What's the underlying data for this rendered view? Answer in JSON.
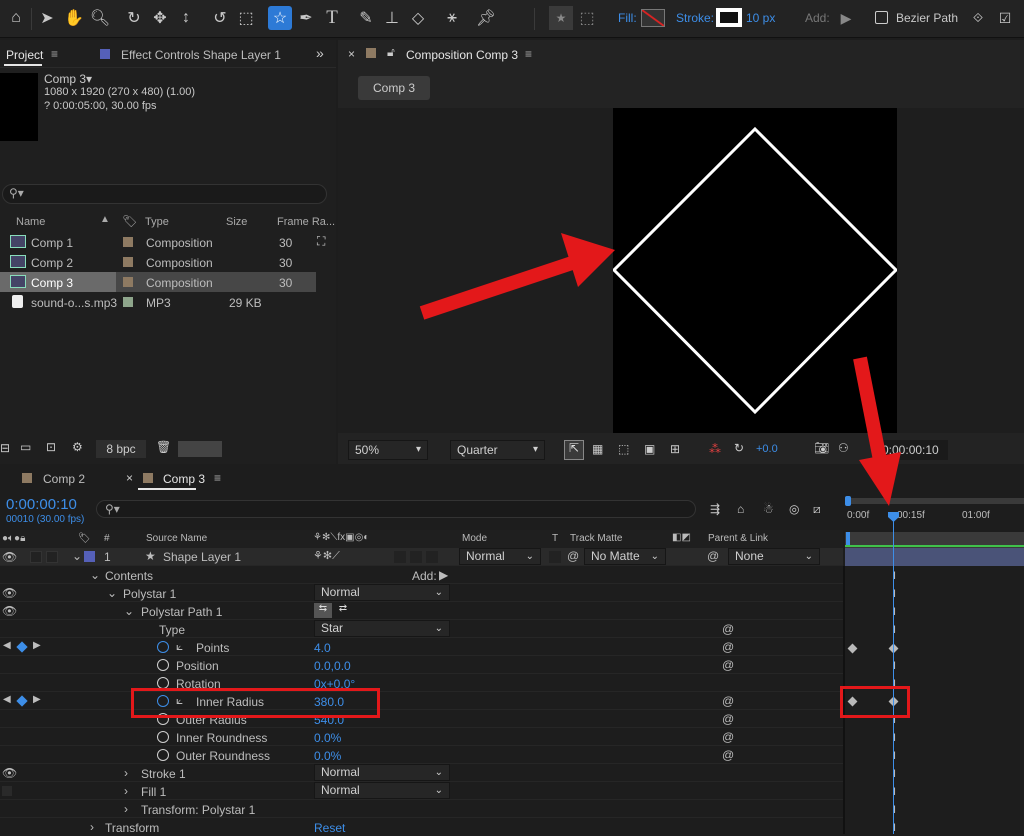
{
  "toolbar": {
    "fill_label": "Fill:",
    "stroke_label": "Stroke:",
    "stroke_width": "10 px",
    "add_label": "Add:",
    "bezier_label": "Bezier Path"
  },
  "project": {
    "tab_project": "Project",
    "tab_effect": "Effect Controls Shape Layer 1",
    "item_name": "Comp 3▾",
    "item_size": "1080 x 1920  (270 x 480) (1.00)",
    "item_duration": "? 0:00:05:00, 30.00 fps",
    "search_placeholder": "",
    "columns": {
      "name": "Name",
      "type": "Type",
      "size": "Size",
      "rate": "Frame Ra..."
    },
    "rows": [
      {
        "name": "Comp 1",
        "type": "Composition",
        "size": "",
        "rate": "30",
        "color": "#8e7a62"
      },
      {
        "name": "Comp 2",
        "type": "Composition",
        "size": "",
        "rate": "30",
        "color": "#8e7a62"
      },
      {
        "name": "Comp 3",
        "type": "Composition",
        "size": "",
        "rate": "30",
        "color": "#8e7a62"
      },
      {
        "name": "sound-o...s.mp3",
        "type": "MP3",
        "size": "29 KB",
        "rate": "",
        "color": "#8ea58b"
      }
    ],
    "bpc": "8 bpc"
  },
  "composition": {
    "tab_title": "Composition Comp 3",
    "breadcrumb": "Comp 3",
    "zoom": "50%",
    "resolution": "Quarter",
    "exposure": "+0.0",
    "timecode": "0:00:00:10"
  },
  "timeline": {
    "tab_comp2": "Comp 2",
    "tab_comp3": "Comp 3",
    "timecode": "0:00:00:10",
    "frame_info": "00010 (30.00 fps)",
    "col_source": "Source Name",
    "col_mode": "Mode",
    "col_t": "T",
    "col_trackmatte": "Track Matte",
    "col_parent": "Parent & Link",
    "col_hash": "#",
    "ruler": [
      "0:00f",
      "00:15f",
      "01:00f"
    ],
    "layer": {
      "num": "1",
      "name": "Shape Layer 1",
      "mode": "Normal",
      "matte": "No Matte",
      "parent": "None"
    },
    "contents_label": "Contents",
    "add_label": "Add:",
    "polystar": "Polystar 1",
    "polystar_mode": "Normal",
    "polystar_path": "Polystar Path 1",
    "props": [
      {
        "name": "Type",
        "value": "Star"
      },
      {
        "name": "Points",
        "value": "4.0"
      },
      {
        "name": "Position",
        "value": "0.0,0.0"
      },
      {
        "name": "Rotation",
        "value": "0x+0.0°"
      },
      {
        "name": "Inner Radius",
        "value": "380.0"
      },
      {
        "name": "Outer Radius",
        "value": "540.0"
      },
      {
        "name": "Inner Roundness",
        "value": "0.0%"
      },
      {
        "name": "Outer Roundness",
        "value": "0.0%"
      }
    ],
    "stroke": "Stroke 1",
    "stroke_mode": "Normal",
    "fill": "Fill 1",
    "fill_mode": "Normal",
    "transform_poly": "Transform: Polystar 1",
    "transform": "Transform",
    "reset": "Reset"
  },
  "colors": {
    "accent": "#3d8ee8",
    "annotation": "#e3181a",
    "layer_label": "#5560b8"
  }
}
